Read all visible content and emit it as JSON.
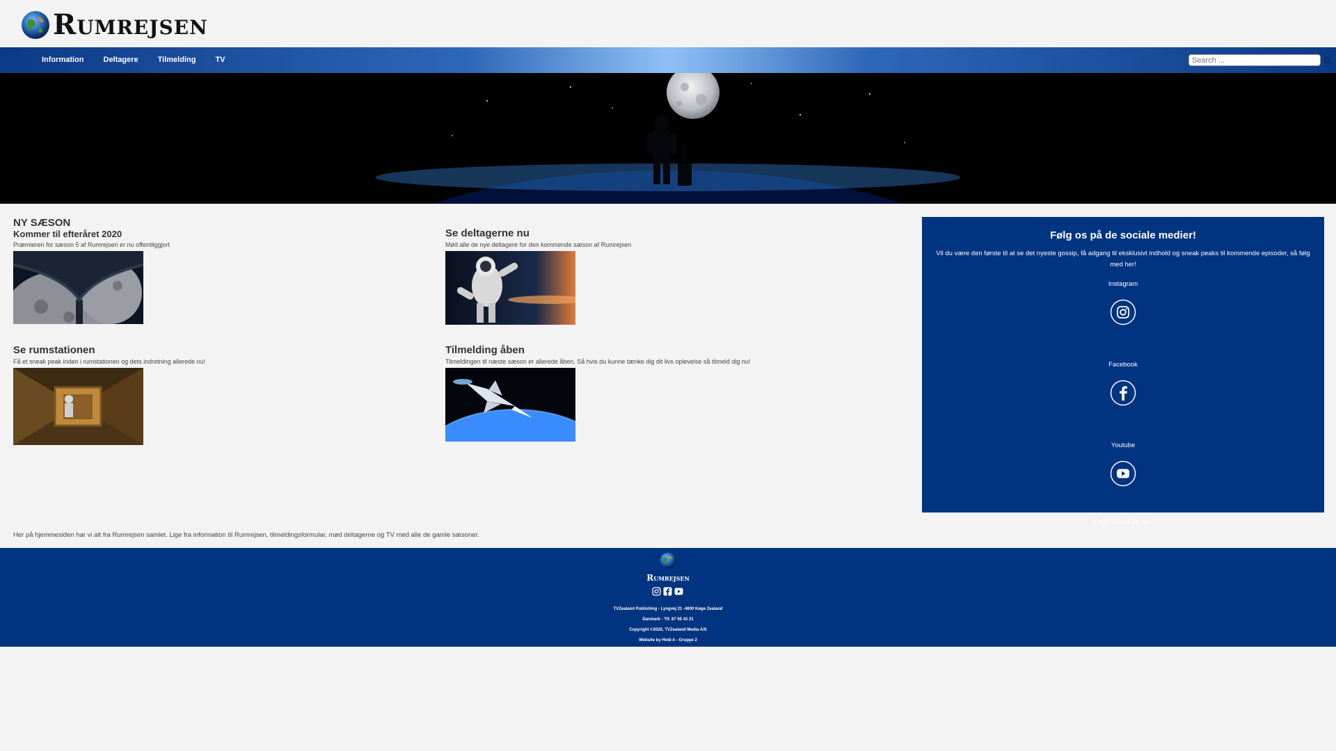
{
  "header": {
    "logo_text": "Rumrejsen"
  },
  "nav": {
    "items": [
      {
        "label": "Information"
      },
      {
        "label": "Deltagere"
      },
      {
        "label": "Tilmelding"
      },
      {
        "label": "TV"
      }
    ],
    "search_placeholder": "Search ..."
  },
  "cards": {
    "season": {
      "kicker": "NY SÆSON",
      "title": "Kommer til efteråret 2020",
      "desc": "Præmieren for sæson 5 af Rumrejsen er nu offentliggjort"
    },
    "participants": {
      "title": "Se deltagerne nu",
      "desc": "Mød alle de nye deltagere for den kommende sæson af Rumrejsen"
    },
    "station": {
      "title": "Se rumstationen",
      "desc": "Få et sneak peak inden i rumstationen og dets indretning allerede nu!"
    },
    "signup": {
      "title": "Tilmelding åben",
      "desc": "Tilmeldingen til næste sæson er allerede åben. Så hvis du kunne tænke dig dit livs oplevelse så tilmeld dig nu!"
    }
  },
  "social": {
    "title": "Følg os på de sociale medier!",
    "intro": "Vil du være den første til at se det nyeste gossip, få adgang til eksklusivt indhold og sneak peaks til kommende episoder, så følg med her!",
    "instagram": "Instagram",
    "facebook": "Facebook",
    "youtube": "Youtube",
    "footer": "Følg os, like og del!"
  },
  "bottom_text": "Her på hjemmesiden har vi alt fra Rumrejsen samlet. Lige fra information til Rumrejsen, tilmeldingsformular, mød deltagerne og TV med alle de gamle sæsoner.",
  "footer": {
    "logo_text": "Rumrejsen",
    "address": "TVZealand Publishing - Lyngvej 21 -4600 Køge Zealand",
    "phone": "Danmark - Tlf. 87 65 43 21",
    "copyright": "Copyright ©2020, TVZealand Media A/S",
    "credit": "Website by Hold A - Gruppe 2"
  },
  "colors": {
    "brand_blue": "#003380",
    "nav_light": "#8fc0f5"
  }
}
